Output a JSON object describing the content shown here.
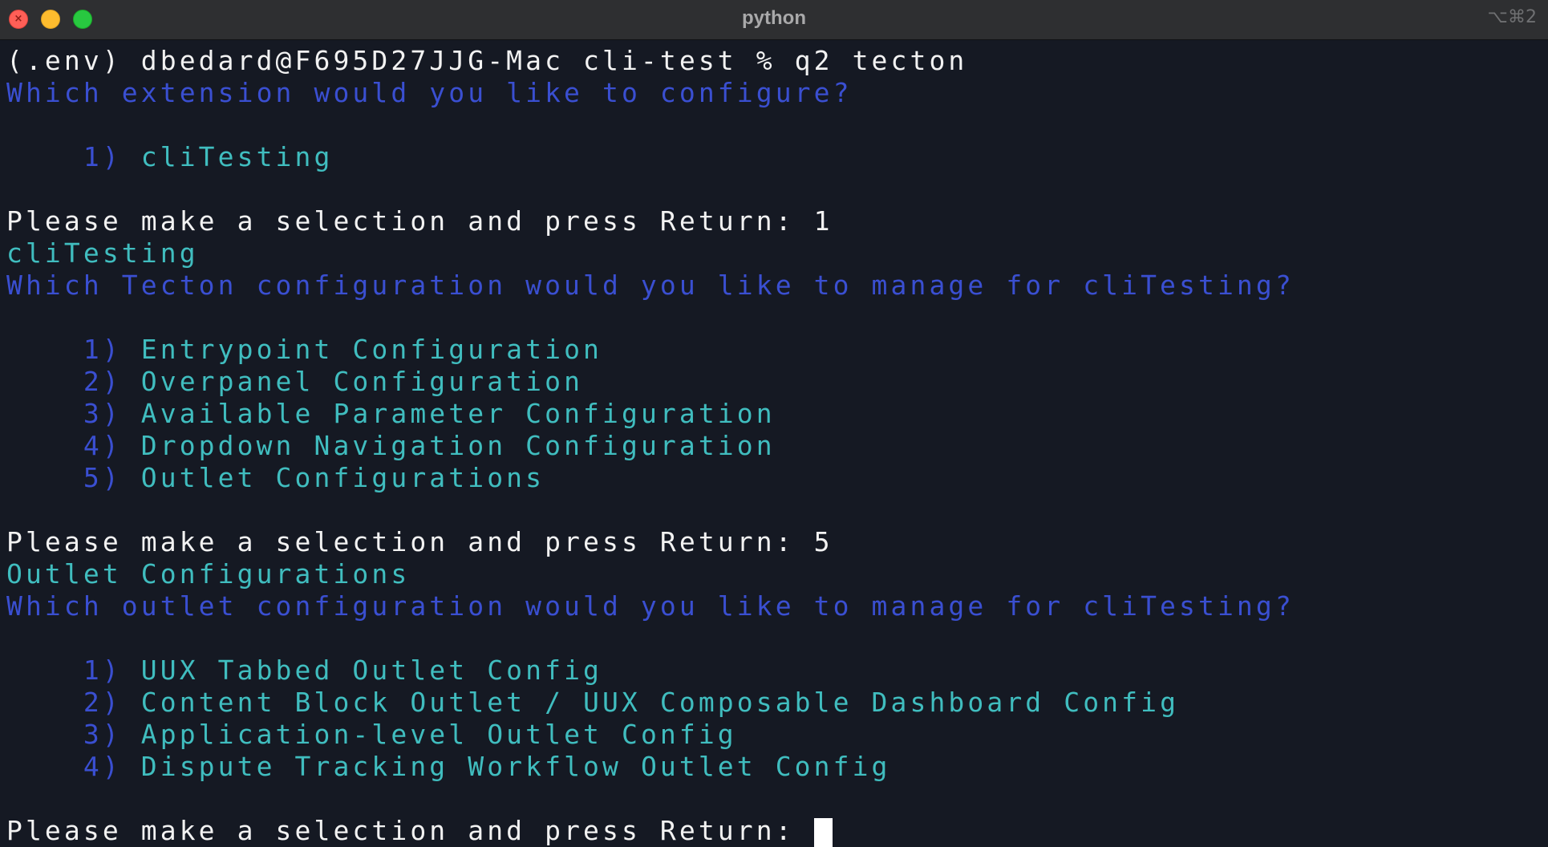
{
  "window": {
    "title": "python",
    "shortcut": "⌥⌘2"
  },
  "terminal": {
    "command_line": "(.env) dbedard@F695D27JJG-Mac cli-test % q2 tecton",
    "q_extension": "Which extension would you like to configure?",
    "ext_options": [
      {
        "num": "1)",
        "label": "cliTesting"
      }
    ],
    "prompt_1": "Please make a selection and press Return: 1",
    "echo_1": "cliTesting",
    "q_tecton": "Which Tecton configuration would you like to manage for cliTesting?",
    "config_options": [
      {
        "num": "1)",
        "label": "Entrypoint Configuration"
      },
      {
        "num": "2)",
        "label": "Overpanel Configuration"
      },
      {
        "num": "3)",
        "label": "Available Parameter Configuration"
      },
      {
        "num": "4)",
        "label": "Dropdown Navigation Configuration"
      },
      {
        "num": "5)",
        "label": "Outlet Configurations"
      }
    ],
    "prompt_2": "Please make a selection and press Return: 5",
    "echo_2": "Outlet Configurations",
    "q_outlet": "Which outlet configuration would you like to manage for cliTesting?",
    "outlet_options": [
      {
        "num": "1)",
        "label": "UUX Tabbed Outlet Config"
      },
      {
        "num": "2)",
        "label": "Content Block Outlet / UUX Composable Dashboard Config"
      },
      {
        "num": "3)",
        "label": "Application-level Outlet Config"
      },
      {
        "num": "4)",
        "label": "Dispute Tracking Workflow Outlet Config"
      }
    ],
    "prompt_3": "Please make a selection and press Return: "
  },
  "colors": {
    "background": "#151923",
    "prompt_text": "#f2f2f2",
    "question_text": "#3a4fd1",
    "option_text": "#40bdbf",
    "titlebar": "#2e2f31"
  }
}
